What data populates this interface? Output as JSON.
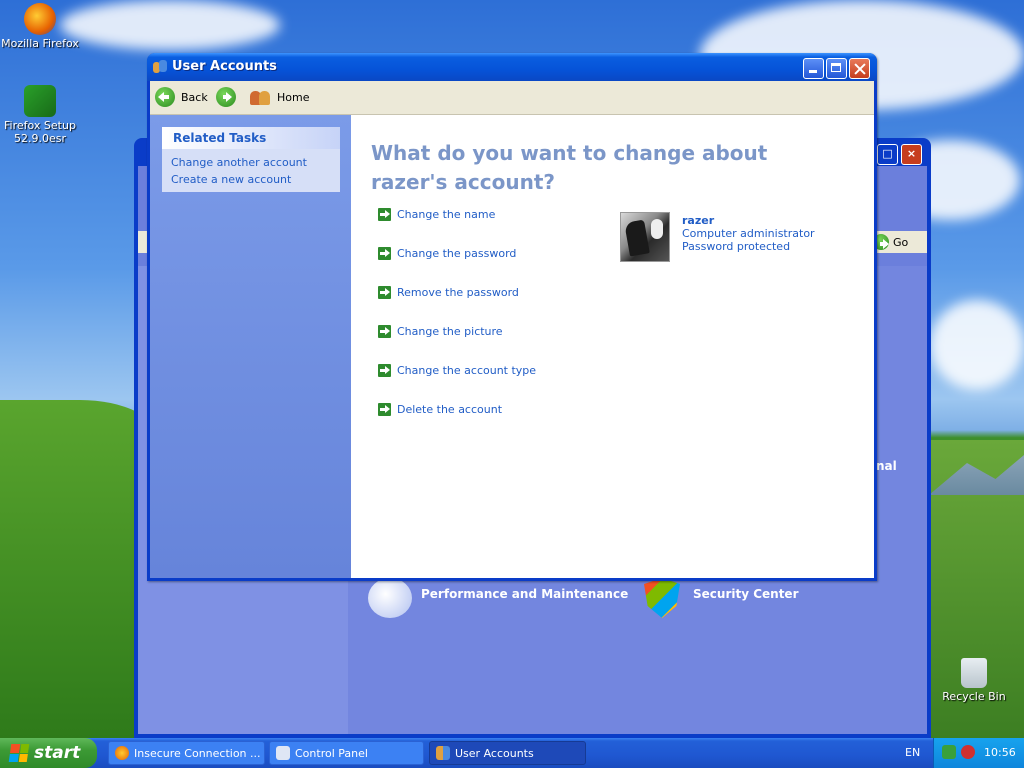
{
  "desktop": {
    "icons": [
      {
        "label": "Mozilla Firefox"
      },
      {
        "label_line1": "Firefox Setup",
        "label_line2": "52.9.0esr"
      },
      {
        "label": "Recycle Bin"
      }
    ]
  },
  "background_window": {
    "go_label": "Go",
    "partial_label": "nal",
    "categories": [
      {
        "label": "Performance and Maintenance"
      },
      {
        "label": "Security Center"
      }
    ]
  },
  "window": {
    "title": "User Accounts",
    "nav": {
      "back_label": "Back",
      "home_label": "Home"
    },
    "related_tasks": {
      "heading": "Related Tasks",
      "links": [
        "Change another account",
        "Create a new account"
      ]
    },
    "heading": "What do you want to change about razer's account?",
    "actions": [
      "Change the name",
      "Change the password",
      "Remove the password",
      "Change the picture",
      "Change the account type",
      "Delete the account"
    ],
    "user": {
      "name": "razer",
      "type": "Computer administrator",
      "status": "Password protected"
    }
  },
  "taskbar": {
    "start_label": "start",
    "buttons": [
      {
        "label": "Insecure Connection ..."
      },
      {
        "label": "Control Panel"
      },
      {
        "label": "User Accounts"
      }
    ],
    "language": "EN",
    "clock": "10:56"
  },
  "colors": {
    "link_blue": "#215dc6",
    "heading_blue": "#7b96c8",
    "title_bar": "#0653d8",
    "start_green": "#3c9a35"
  }
}
